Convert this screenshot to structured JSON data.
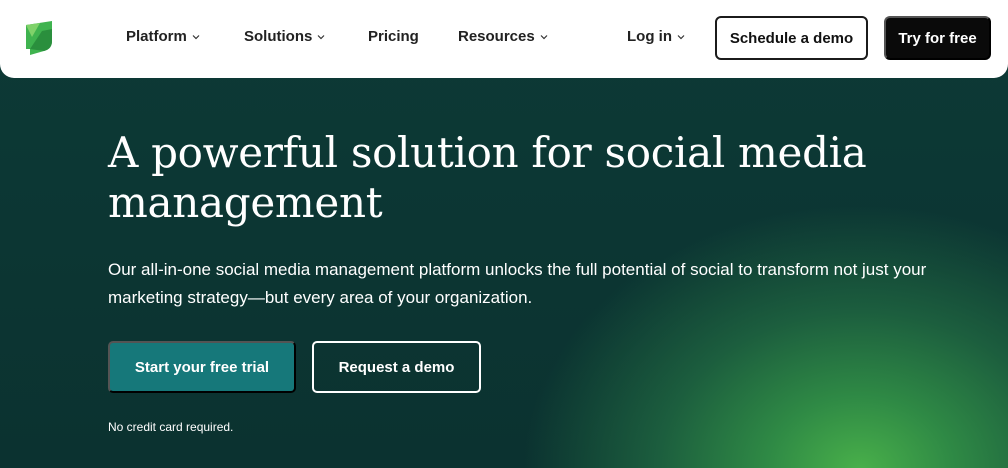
{
  "nav": {
    "logo_icon": "sprout-leaf-logo",
    "items": [
      {
        "label": "Platform",
        "dropdown": true
      },
      {
        "label": "Solutions",
        "dropdown": true
      },
      {
        "label": "Pricing",
        "dropdown": false
      },
      {
        "label": "Resources",
        "dropdown": true
      }
    ],
    "login_label": "Log in",
    "schedule_demo_label": "Schedule a demo",
    "try_free_label": "Try for free"
  },
  "hero": {
    "headline": "A powerful solution for social media management",
    "subtext": "Our all-in-one social media management platform unlocks the full potential of social to transform not just your marketing strategy—but every area of your organization.",
    "primary_cta": "Start your free trial",
    "secondary_cta": "Request a demo",
    "note": "No credit card required."
  },
  "colors": {
    "hero_background": "#0b2e2c",
    "glow": "#49b04a",
    "primary_button": "#16787a",
    "logo_green": "#3fb34f"
  }
}
